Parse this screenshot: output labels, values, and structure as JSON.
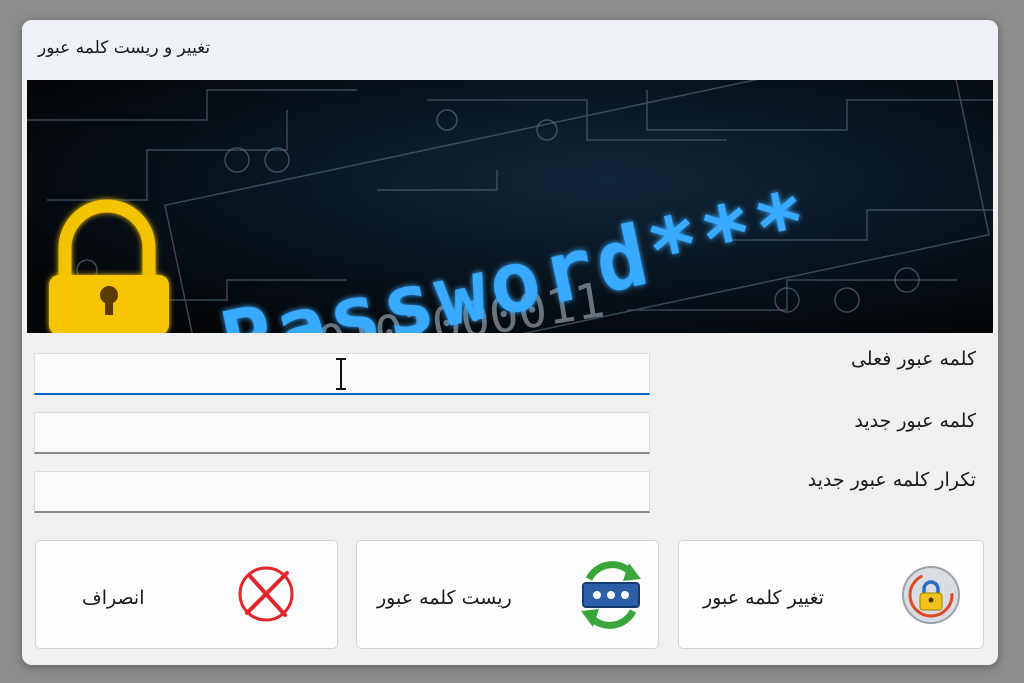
{
  "window": {
    "title": "تغییر و ریست کلمه عبور"
  },
  "banner": {
    "text": "Password***",
    "binary_row": "0101000011",
    "colors": {
      "background": "#05080d",
      "glow": "#36a8ff",
      "lock": "#f3c300"
    }
  },
  "form": {
    "current_password": {
      "label": "کلمه عبور فعلی",
      "value": ""
    },
    "new_password": {
      "label": "کلمه عبور جدید",
      "value": ""
    },
    "confirm_password": {
      "label": "تکرار کلمه عبور جدید",
      "value": ""
    }
  },
  "buttons": {
    "change": {
      "label": "تغییر کلمه عبور",
      "icon": "lock-refresh-icon"
    },
    "reset": {
      "label": "ریست کلمه عبور",
      "icon": "password-reset-icon"
    },
    "cancel": {
      "label": "انصراف",
      "icon": "cancel-x-icon"
    }
  },
  "colors": {
    "accent": "#0a62c4"
  }
}
